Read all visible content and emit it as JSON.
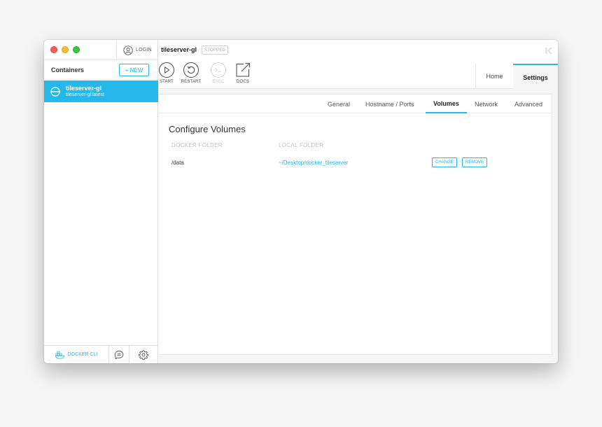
{
  "sidebar": {
    "login_label": "LOGIN",
    "title": "Containers",
    "new_button": "+ NEW",
    "containers": [
      {
        "name": "tileserver-gl",
        "image": "tileserver-gl:latest"
      }
    ],
    "docker_cli_label": "DOCKER CLI"
  },
  "header": {
    "container_name": "tileserver-gl",
    "state": "STOPPED",
    "actions": [
      {
        "label": "START",
        "icon": "play-icon",
        "enabled": true
      },
      {
        "label": "RESTART",
        "icon": "restart-icon",
        "enabled": true
      },
      {
        "label": "EXEC",
        "icon": "terminal-icon",
        "enabled": false
      },
      {
        "label": "DOCS",
        "icon": "external-link-icon",
        "enabled": true
      }
    ],
    "tabs": [
      "Home",
      "Settings"
    ],
    "active_tab": "Settings"
  },
  "settings": {
    "subtabs": [
      "General",
      "Hostname / Ports",
      "Volumes",
      "Network",
      "Advanced"
    ],
    "active_subtab": "Volumes",
    "section_title": "Configure Volumes",
    "columns": [
      "DOCKER FOLDER",
      "LOCAL FOLDER"
    ],
    "volumes": [
      {
        "docker_folder": "/data",
        "local_folder": "~/Desktop/docker_tileserver",
        "change_label": "CHANGE",
        "remove_label": "REMOVE"
      }
    ]
  },
  "colors": {
    "accent": "#24b8eb",
    "traffic_red": "#fc5b57",
    "traffic_yellow": "#fdbd2f",
    "traffic_green": "#35c840"
  }
}
